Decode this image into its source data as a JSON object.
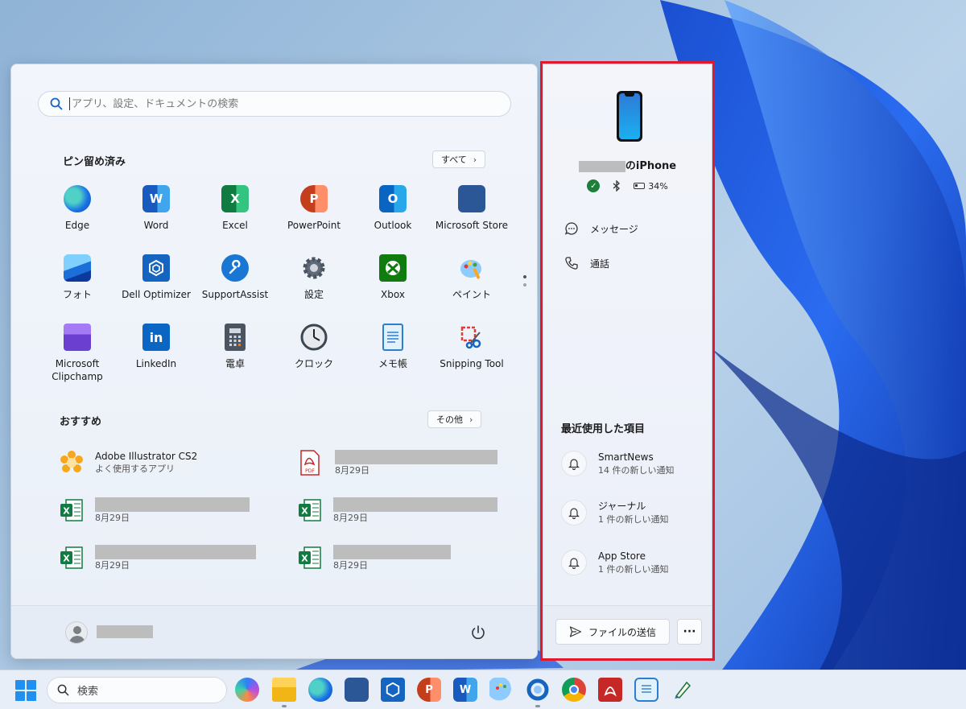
{
  "colors": {
    "accent": "#1f8ff0",
    "highlight_frame": "#e0192e",
    "status_ok": "#1c7f3a"
  },
  "start_menu": {
    "search_placeholder": "アプリ、設定、ドキュメントの検索",
    "pinned": {
      "title": "ピン留め済み",
      "all_button": "すべて",
      "apps": [
        {
          "label": "Edge",
          "icon": "edge-icon"
        },
        {
          "label": "Word",
          "icon": "word-icon"
        },
        {
          "label": "Excel",
          "icon": "excel-icon"
        },
        {
          "label": "PowerPoint",
          "icon": "powerpoint-icon"
        },
        {
          "label": "Outlook",
          "icon": "outlook-icon"
        },
        {
          "label": "Microsoft Store",
          "icon": "store-icon"
        },
        {
          "label": "フォト",
          "icon": "photos-icon"
        },
        {
          "label": "Dell Optimizer",
          "icon": "dell-optimizer-icon"
        },
        {
          "label": "SupportAssist",
          "icon": "supportassist-icon"
        },
        {
          "label": "設定",
          "icon": "settings-gear-icon"
        },
        {
          "label": "Xbox",
          "icon": "xbox-icon"
        },
        {
          "label": "ペイント",
          "icon": "paint-icon"
        },
        {
          "label": "Microsoft Clipchamp",
          "icon": "clipchamp-icon"
        },
        {
          "label": "LinkedIn",
          "icon": "linkedin-icon"
        },
        {
          "label": "電卓",
          "icon": "calculator-icon"
        },
        {
          "label": "クロック",
          "icon": "clock-icon"
        },
        {
          "label": "メモ帳",
          "icon": "notepad-icon"
        },
        {
          "label": "Snipping Tool",
          "icon": "snipping-tool-icon"
        }
      ]
    },
    "recommended": {
      "title": "おすすめ",
      "more_button": "その他",
      "items": [
        {
          "title": "Adobe Illustrator CS2",
          "subtitle": "よく使用するアプリ",
          "icon": "illustrator-icon"
        },
        {
          "title": "",
          "subtitle": "8月29日",
          "icon": "pdf-file-icon"
        },
        {
          "title": "",
          "subtitle": "8月29日",
          "icon": "excel-file-icon"
        },
        {
          "title": "",
          "subtitle": "8月29日",
          "icon": "excel-file-icon"
        },
        {
          "title": "",
          "subtitle": "8月29日",
          "icon": "excel-file-icon"
        },
        {
          "title": "",
          "subtitle": "8月29日",
          "icon": "excel-file-icon"
        }
      ]
    }
  },
  "phone_panel": {
    "device_name_suffix": "のiPhone",
    "battery": "34%",
    "links": {
      "messages": "メッセージ",
      "calls": "通話"
    },
    "recent_title": "最近使用した項目",
    "notifications": [
      {
        "app": "SmartNews",
        "detail": "14 件の新しい通知"
      },
      {
        "app": "ジャーナル",
        "detail": "1 件の新しい通知"
      },
      {
        "app": "App Store",
        "detail": "1 件の新しい通知"
      }
    ],
    "send_file": "ファイルの送信",
    "more": "···"
  },
  "taskbar": {
    "search_label": "検索",
    "icons": [
      "copilot-icon",
      "file-explorer-icon",
      "edge-icon",
      "store-icon",
      "dell-optimizer-icon",
      "powerpoint-icon",
      "word-icon",
      "paint-icon",
      "phone-link-icon",
      "chrome-icon",
      "acrobat-icon",
      "notepad-icon",
      "illustrator-pen-icon"
    ]
  }
}
